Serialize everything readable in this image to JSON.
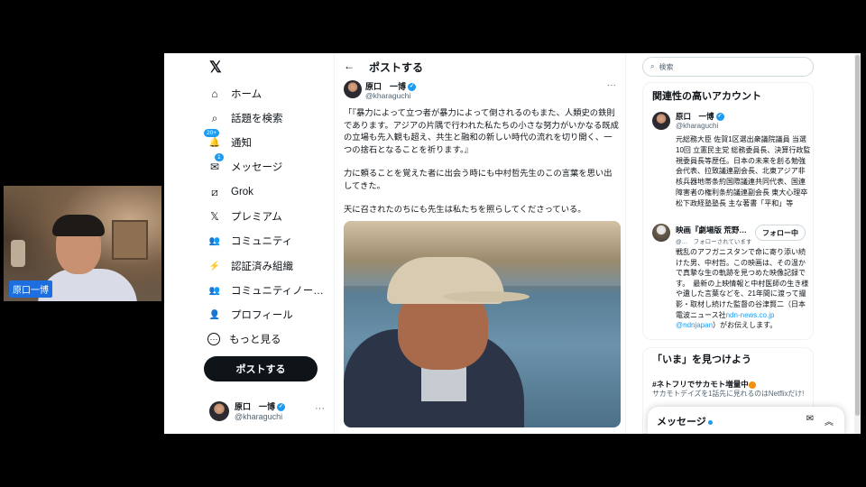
{
  "webcam": {
    "name_tag": "原口一博"
  },
  "nav": {
    "logo": "𝕏",
    "items": [
      {
        "label": "ホーム",
        "icon": "home-icon",
        "glyph": "⌂"
      },
      {
        "label": "話題を検索",
        "icon": "search-icon",
        "glyph": "⌕"
      },
      {
        "label": "通知",
        "icon": "bell-icon",
        "glyph": "🔔",
        "badge": "20+"
      },
      {
        "label": "メッセージ",
        "icon": "mail-icon",
        "glyph": "✉",
        "badge": "1"
      },
      {
        "label": "Grok",
        "icon": "grok-icon",
        "glyph": "⧄"
      },
      {
        "label": "プレミアム",
        "icon": "x-premium-icon",
        "glyph": "𝕏"
      },
      {
        "label": "コミュニティ",
        "icon": "community-icon",
        "glyph": "👥"
      },
      {
        "label": "認証済み組織",
        "icon": "lightning-icon",
        "glyph": "⚡"
      },
      {
        "label": "コミュニティノー…",
        "icon": "community-notes-icon",
        "glyph": "👥"
      },
      {
        "label": "プロフィール",
        "icon": "profile-icon",
        "glyph": "👤"
      },
      {
        "label": "もっと見る",
        "icon": "more-circle-icon",
        "glyph": "⋯"
      }
    ],
    "post_button": "ポストする",
    "account": {
      "name": "原口　一博",
      "handle": "@kharaguchi",
      "more": "···"
    }
  },
  "main": {
    "back": "←",
    "title": "ポストする",
    "author": {
      "name": "原口　一博",
      "handle": "@kharaguchi",
      "more": "···"
    },
    "paragraphs": [
      "「『暴力によって立つ者が暴力によって倒されるのもまた、人類史の鉄則であります。アジアの片隅で行われた私たちの小さな努力がいかなる既成の立場も先入観も超え、共生と融和の新しい時代の流れを切り開く、一つの捨石となることを祈ります。』",
      "力に頼ることを覚えた者に出会う時にも中村哲先生のこの言葉を思い出してきた。",
      "天に召されたのちにも先生は私たちを照らしてくださっている。"
    ]
  },
  "right": {
    "search_placeholder": "検索",
    "related_title": "関連性の高いアカウント",
    "acc1": {
      "name": "原口　一博",
      "handle": "@kharaguchi",
      "bio": "元総務大臣 佐賀1区選出衆議院議員 当選10回 立憲民主党 総務委員長、決算行政監視委員長等歴任。日本の未来を創る勉強会代表、拉致議連副会長、北東アジア非核兵器地帯条約国際議連共同代表、国連障害者の権利条約議連副会長 東大心理卒松下政経塾塾長 主な著書「平和」等"
    },
    "acc2": {
      "name": "映画『劇場版 荒野…",
      "handle": "@…　フォローされています",
      "follow": "フォロー中",
      "bio": "戦乱のアフガニスタンで命に寄り添い続けた男、中村哲。この映画は、その温かで真摯な生の軌跡を見つめた映像記録です。　最新の上映情報と中村医師の生き様や遺した言葉などを、21年間に渡って撮影・取材し続けた監督の谷津賢二（日本電波ニュース社",
      "link": "ndn-news.co.jp @ndnjapan",
      "bio_end": "）がお伝えします。"
    },
    "trending_title": "「いま」を見つけよう",
    "trend": {
      "title": "#ネトフリでサカモト増量中",
      "desc": "サカモトデイズを1話先に見れるのはNetflixだけ!"
    }
  },
  "messages": {
    "label": "メッセージ"
  }
}
